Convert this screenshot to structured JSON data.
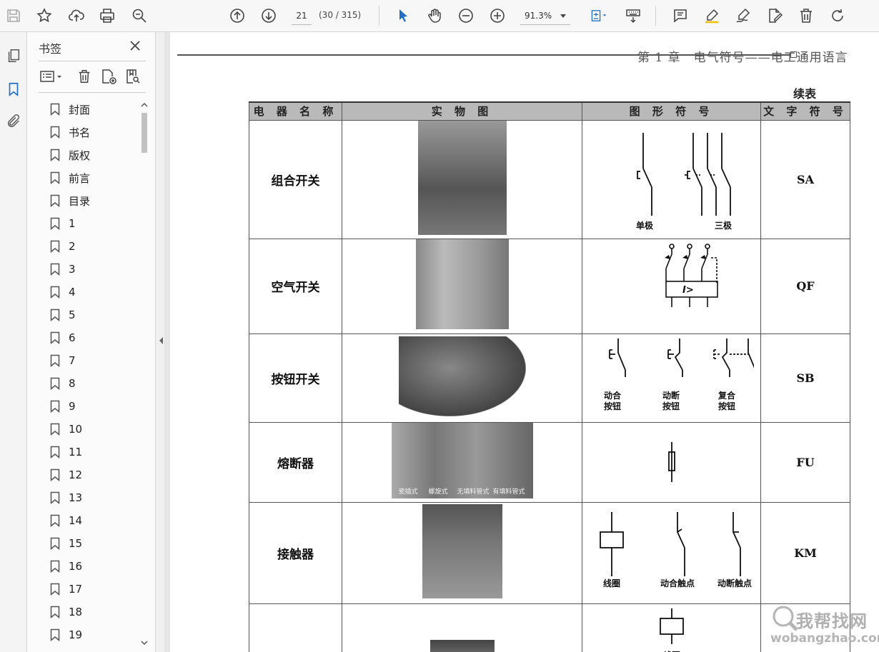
{
  "toolbar": {
    "page_number": "21",
    "page_count": "(30 / 315)",
    "zoom": "91.3%"
  },
  "panel": {
    "title": "书签",
    "bookmarks": [
      "封面",
      "书名",
      "版权",
      "前言",
      "目录",
      "1",
      "2",
      "3",
      "4",
      "5",
      "6",
      "7",
      "8",
      "9",
      "10",
      "11",
      "12",
      "13",
      "14",
      "15",
      "16",
      "17",
      "18",
      "19"
    ]
  },
  "document": {
    "header": "第 1 章　电气符号——电工通用语言",
    "continued": "续表",
    "columns": [
      "电 器 名 称",
      "实 物 图",
      "图 形 符 号",
      "文 字 符 号"
    ],
    "rows": [
      {
        "name": "组合开关",
        "code": "SA",
        "symbol_labels": [
          "单极",
          "三极"
        ]
      },
      {
        "name": "空气开关",
        "code": "QF",
        "symbol_labels": [
          "I>"
        ]
      },
      {
        "name": "按钮开关",
        "code": "SB",
        "symbol_labels": [
          "动合\n按钮",
          "动断\n按钮",
          "复合\n按钮"
        ]
      },
      {
        "name": "熔断器",
        "code": "FU",
        "symbol_labels": [],
        "photo_labels": [
          "瓷插式",
          "螺旋式",
          "无填料管式",
          "有填料管式"
        ]
      },
      {
        "name": "接触器",
        "code": "KM",
        "symbol_labels": [
          "线圈",
          "动合触点",
          "动断触点"
        ]
      },
      {
        "name": "",
        "code": "",
        "symbol_labels": [
          "线圈"
        ]
      }
    ]
  },
  "watermark": {
    "text": "我帮找网",
    "url": "wobangzhao.com"
  }
}
